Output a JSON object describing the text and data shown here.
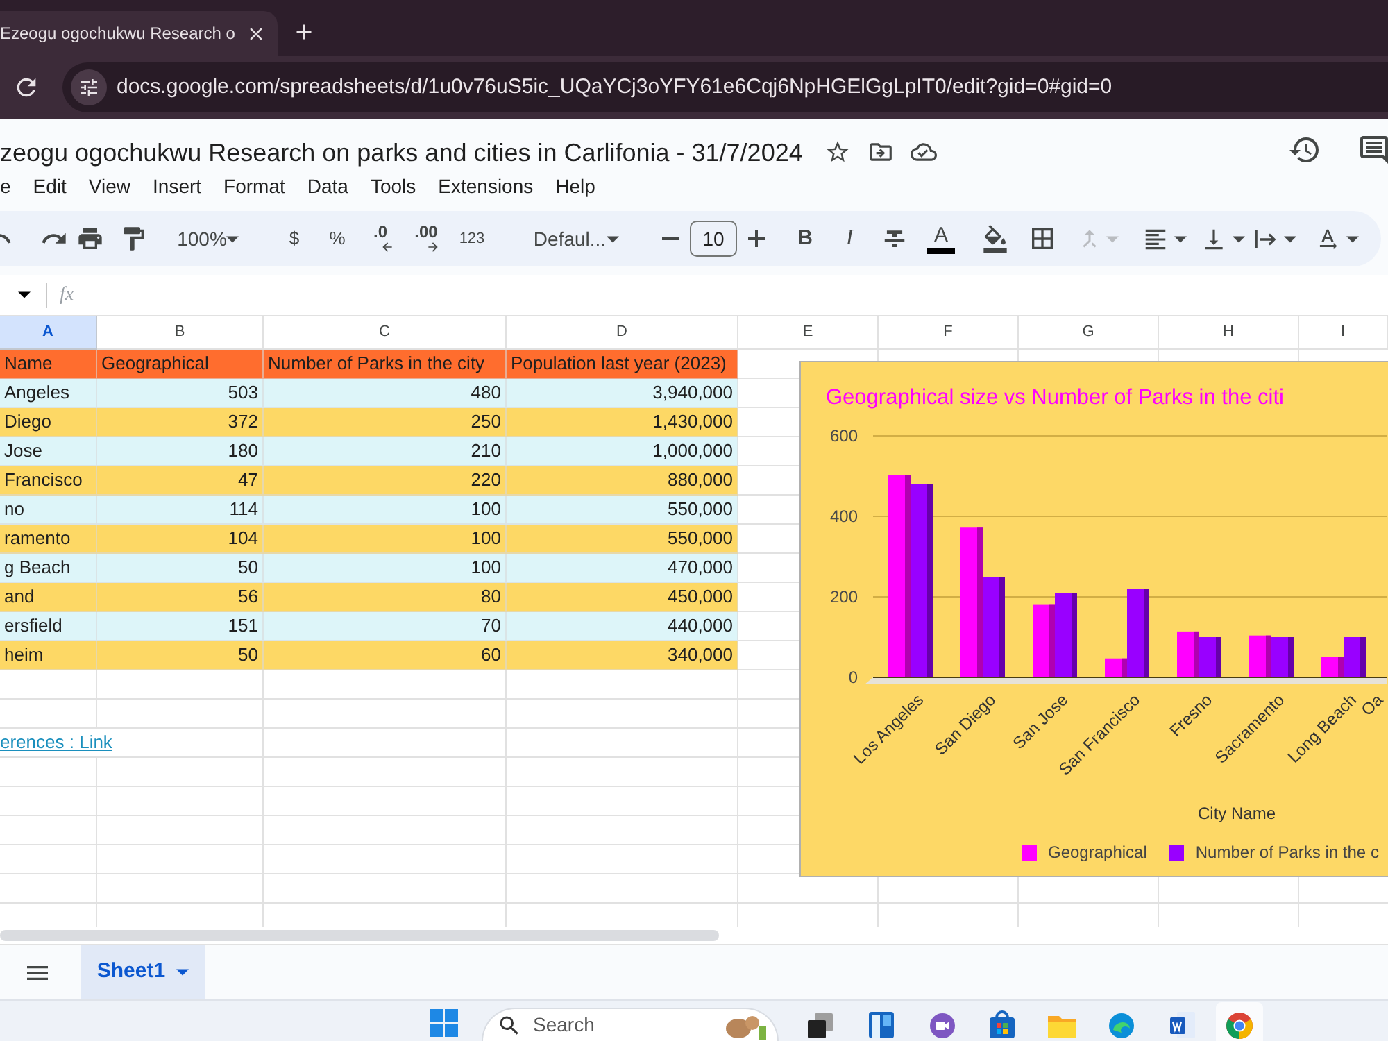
{
  "browser": {
    "tab": {
      "title": "Ezeogu ogochukwu Research o"
    },
    "url": "docs.google.com/spreadsheets/d/1u0v76uS5ic_UQaYCj3oYFY61e6Cqj6NpHGElGgLpIT0/edit?gid=0#gid=0"
  },
  "document": {
    "title": "zeogu ogochukwu Research on parks and cities in Carlifonia - 31/7/2024"
  },
  "menu": [
    "e",
    "Edit",
    "View",
    "Insert",
    "Format",
    "Data",
    "Tools",
    "Extensions",
    "Help"
  ],
  "toolbar": {
    "zoom": "100%",
    "currency": "$",
    "percent": "%",
    "decrease_decimal": ".0",
    "increase_decimal": ".00",
    "number_format": "123",
    "font": "Defaul...",
    "font_size": "10",
    "bold": "B",
    "italic": "I",
    "text_color": "A",
    "merge": {
      "disabled": true
    }
  },
  "formula_bar": {
    "function_label": "fx"
  },
  "sheet": {
    "columns": [
      {
        "label": "A",
        "selected": true
      },
      {
        "label": "B",
        "selected": false
      },
      {
        "label": "C",
        "selected": false
      },
      {
        "label": "D",
        "selected": false
      },
      {
        "label": "E",
        "selected": false
      },
      {
        "label": "F",
        "selected": false
      },
      {
        "label": "G",
        "selected": false
      },
      {
        "label": "H",
        "selected": false
      },
      {
        "label": "I",
        "selected": false
      }
    ],
    "rows": [
      {
        "kind": "header",
        "color": "#ff6d2e",
        "cells": [
          "Name",
          "Geographical",
          "Number of Parks in the city",
          "Population last year (2023)"
        ]
      },
      {
        "kind": "data",
        "color": "#ddf5f9",
        "cells": [
          "Angeles",
          "503",
          "480",
          "3,940,000"
        ]
      },
      {
        "kind": "data",
        "color": "#fdd865",
        "cells": [
          "Diego",
          "372",
          "250",
          "1,430,000"
        ]
      },
      {
        "kind": "data",
        "color": "#ddf5f9",
        "cells": [
          "Jose",
          "180",
          "210",
          "1,000,000"
        ]
      },
      {
        "kind": "data",
        "color": "#fdd865",
        "cells": [
          "Francisco",
          "47",
          "220",
          "880,000"
        ]
      },
      {
        "kind": "data",
        "color": "#ddf5f9",
        "cells": [
          "no",
          "114",
          "100",
          "550,000"
        ]
      },
      {
        "kind": "data",
        "color": "#fdd865",
        "cells": [
          "ramento",
          "104",
          "100",
          "550,000"
        ]
      },
      {
        "kind": "data",
        "color": "#ddf5f9",
        "cells": [
          "g Beach",
          "50",
          "100",
          "470,000"
        ]
      },
      {
        "kind": "data",
        "color": "#fdd865",
        "cells": [
          "and",
          "56",
          "80",
          "450,000"
        ]
      },
      {
        "kind": "data",
        "color": "#ddf5f9",
        "cells": [
          "ersfield",
          "151",
          "70",
          "440,000"
        ]
      },
      {
        "kind": "data",
        "color": "#fdd865",
        "cells": [
          "heim",
          "50",
          "60",
          "340,000"
        ]
      }
    ],
    "link": "erences : Link"
  },
  "chart": {
    "chart_data": {
      "type": "bar",
      "title": "Geographical size vs Number of Parks in the citi",
      "xlabel": "City Name",
      "categories": [
        "Los Angeles",
        "San Diego",
        "San Jose",
        "San Francisco",
        "Fresno",
        "Sacramento",
        "Long Beach",
        "Oa"
      ],
      "series": [
        {
          "name": "Geographical",
          "color": "#ff00ff",
          "values": [
            503,
            372,
            180,
            47,
            114,
            104,
            50,
            null
          ]
        },
        {
          "name": "Number of Parks in the c",
          "color": "#9900ff",
          "values": [
            480,
            250,
            210,
            220,
            100,
            100,
            100,
            null
          ]
        }
      ],
      "ylim": [
        0,
        600
      ],
      "yticks": [
        0,
        200,
        400,
        600
      ],
      "legend": "bottom"
    }
  },
  "sheet_tabs": [
    {
      "label": "Sheet1",
      "selected": true
    }
  ],
  "taskbar": {
    "search": {
      "placeholder": "Search"
    }
  }
}
